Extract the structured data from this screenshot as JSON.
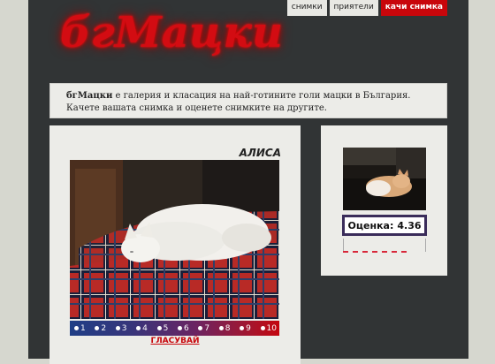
{
  "header": {
    "logo_text": "бгМацки",
    "nav": [
      {
        "label": "снимки"
      },
      {
        "label": "приятели"
      },
      {
        "label": "качи снимка"
      }
    ]
  },
  "intro": {
    "brand": "бгМацки",
    "text": " е галерия и класация на най-готините голи мацки в България. Качете вашата снимка и оценете снимките на другите."
  },
  "main": {
    "cat_name": "АЛИСА",
    "vote_options": [
      "1",
      "2",
      "3",
      "4",
      "5",
      "6",
      "7",
      "8",
      "9",
      "10"
    ],
    "vote_label": "ГЛАСУВАЙ"
  },
  "side": {
    "rating_label": "Оценка:",
    "rating_value": "4.36"
  },
  "colors": {
    "accent": "#c8060b",
    "page_bg": "#313435",
    "card_bg": "#ecece8"
  }
}
